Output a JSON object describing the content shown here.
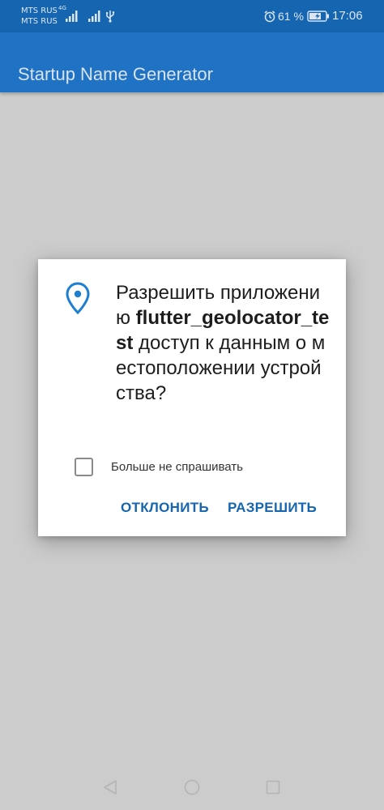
{
  "status_bar": {
    "carrier_1": "MTS RUS",
    "carrier_1_network": "4G",
    "carrier_2": "MTS RUS",
    "battery_percent": "61 %",
    "time": "17:06",
    "icons": [
      "signal-icon",
      "usb-icon",
      "alarm-icon",
      "battery-charging-icon"
    ]
  },
  "app_bar": {
    "title": "Startup Name Generator"
  },
  "dialog": {
    "icon": "location-pin-icon",
    "message_before": "Разрешить приложению ",
    "app_name": "flutter_geolocator_test",
    "message_after": " доступ к данным о местоположении устройства?",
    "checkbox_label": "Больше не спрашивать",
    "checkbox_checked": false,
    "deny_label": "ОТКЛОНИТЬ",
    "allow_label": "РАЗРЕШИТЬ",
    "accent_color": "#1565b0"
  },
  "nav_bar": {
    "icons": [
      "back-icon",
      "home-icon",
      "recent-apps-icon"
    ]
  }
}
